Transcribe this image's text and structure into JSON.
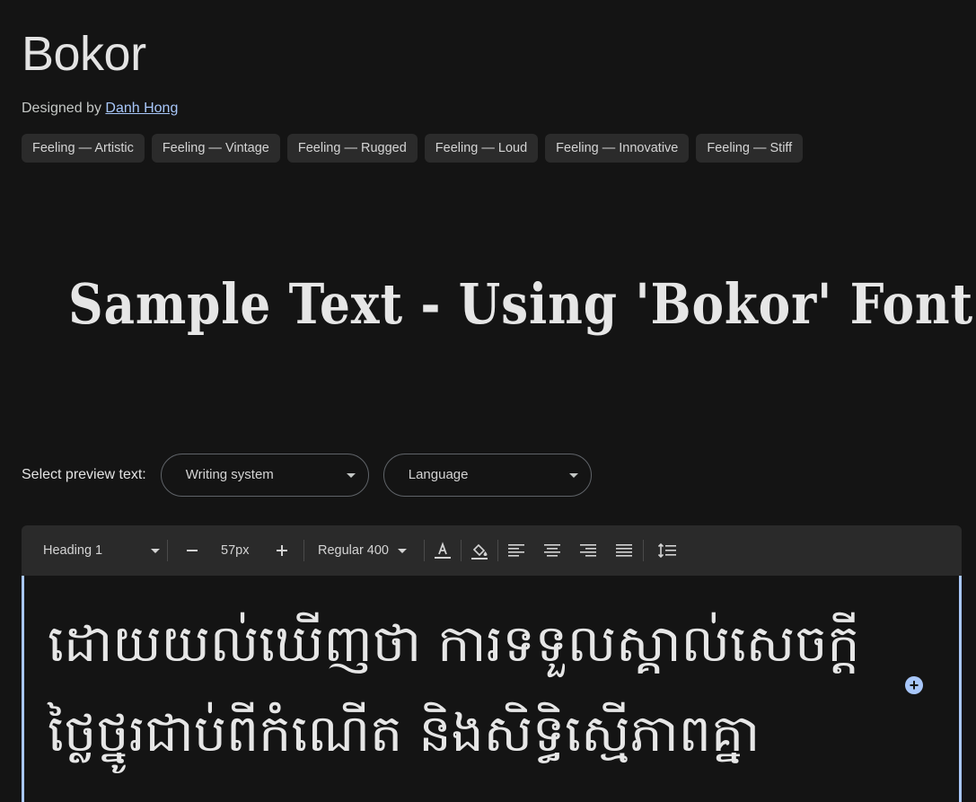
{
  "font": {
    "name": "Bokor",
    "designed_by_label": "Designed by",
    "designer": "Danh Hong"
  },
  "tags": [
    "Feeling — Artistic",
    "Feeling — Vintage",
    "Feeling — Rugged",
    "Feeling — Loud",
    "Feeling — Innovative",
    "Feeling — Stiff"
  ],
  "sample_text": "Sample Text - Using 'Bokor' Font.",
  "preview": {
    "label": "Select preview text:",
    "writing_system": "Writing system",
    "language": "Language"
  },
  "toolbar": {
    "style": "Heading 1",
    "size": "57px",
    "weight": "Regular 400"
  },
  "editor": {
    "text": "ដោយយល់ឃើញថា ការទទួលស្គាល់សេចក្ដីថ្លៃថ្នូរជាប់ពីកំណើត និងសិទ្ធិស្មើភាពគ្នា"
  },
  "colors": {
    "background": "#141414",
    "accent": "#a8c7fa",
    "chip": "#2b2b2b",
    "toolbar": "#2a2a2a"
  }
}
